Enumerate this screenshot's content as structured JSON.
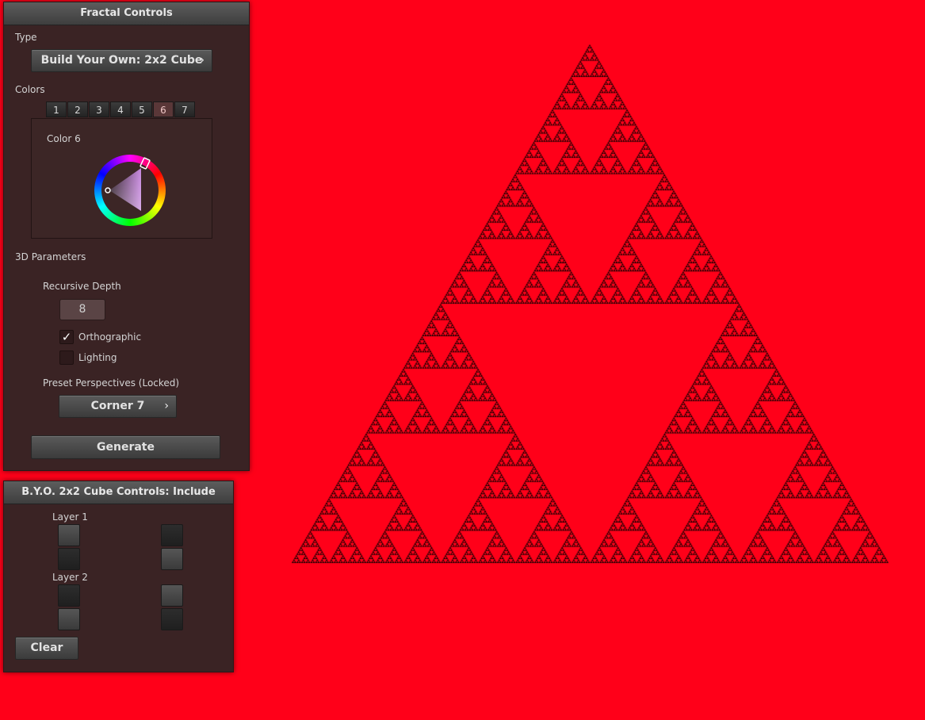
{
  "fractal_controls": {
    "title": "Fractal Controls",
    "type_label": "Type",
    "type_value": "Build Your Own: 2x2 Cube",
    "colors_label": "Colors",
    "color_tabs": [
      "1",
      "2",
      "3",
      "4",
      "5",
      "6",
      "7"
    ],
    "active_color_tab": "6",
    "color_title": "Color 6",
    "selected_hue_color": "#c078d8",
    "params_label": "3D Parameters",
    "depth_label": "Recursive Depth",
    "depth_value": "8",
    "orthographic_label": "Orthographic",
    "orthographic_checked": true,
    "lighting_label": "Lighting",
    "lighting_checked": false,
    "presets_label": "Preset Perspectives (Locked)",
    "preset_value": "Corner 7",
    "generate_label": "Generate"
  },
  "cube_controls": {
    "title": "B.Y.O. 2x2 Cube Controls: Include",
    "layers": [
      {
        "label": "Layer 1",
        "cells": [
          true,
          false,
          false,
          true
        ]
      },
      {
        "label": "Layer 2",
        "cells": [
          false,
          true,
          true,
          false
        ]
      }
    ],
    "clear_label": "Clear"
  },
  "canvas": {
    "background_color": "#ff0019",
    "fractal_color": "#000000",
    "fractal": "sierpinski-triangle",
    "depth": 8
  }
}
